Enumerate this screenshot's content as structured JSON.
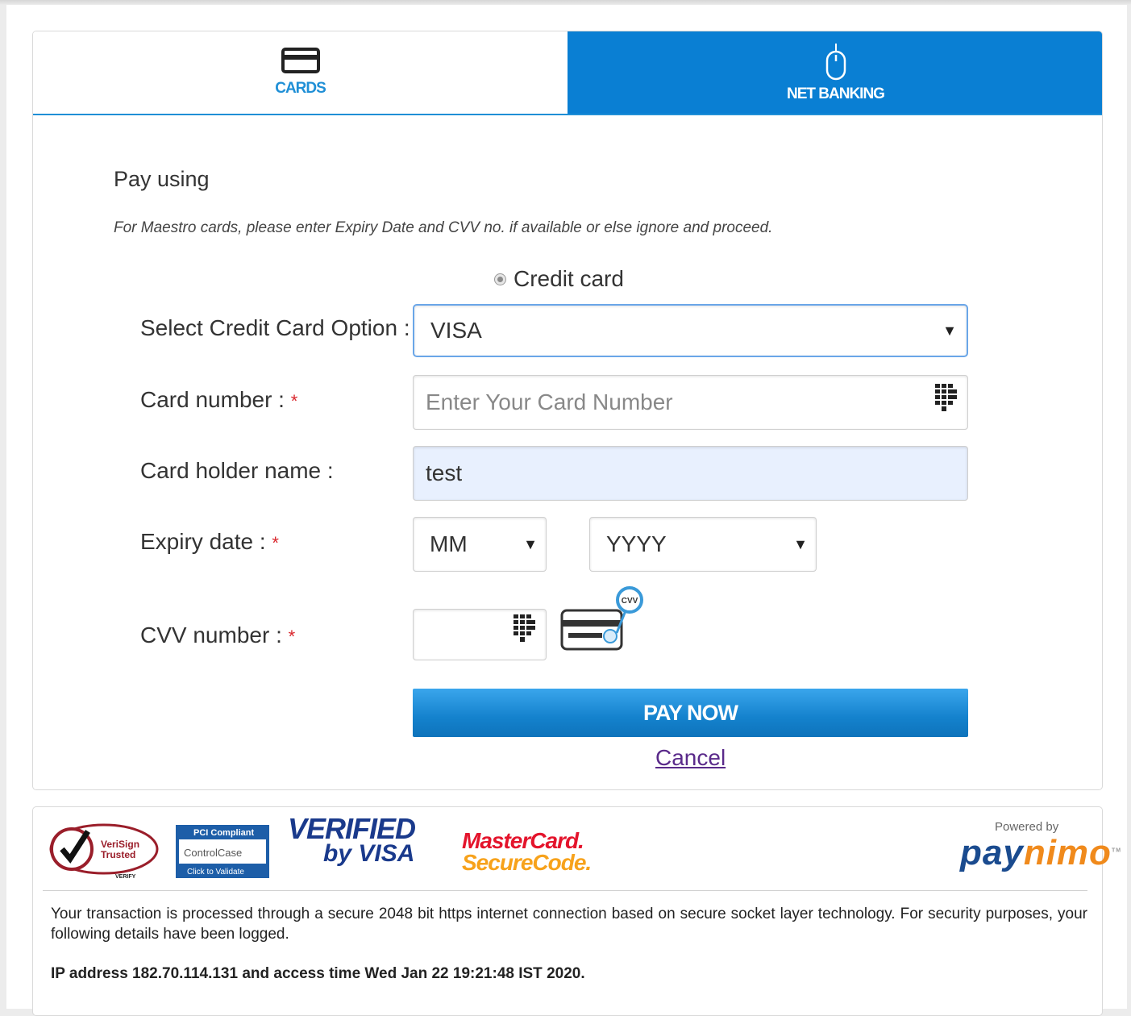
{
  "tabs": {
    "cards": {
      "label": "CARDS",
      "icon": "credit-card-icon"
    },
    "net_banking": {
      "label": "NET BANKING",
      "icon": "mouse-icon"
    }
  },
  "form": {
    "heading": "Pay using",
    "note": "For Maestro cards, please enter Expiry Date and CVV no. if available or else ignore and proceed.",
    "payment_method": {
      "label": "Credit card",
      "selected": true
    },
    "card_option": {
      "label": "Select Credit Card Option :",
      "value": "VISA"
    },
    "card_number": {
      "label": "Card number :",
      "required_mark": "*",
      "placeholder": "Enter Your Card Number",
      "value": ""
    },
    "holder_name": {
      "label": "Card holder name :",
      "value": "test"
    },
    "expiry": {
      "label": "Expiry date :",
      "required_mark": "*",
      "month": "MM",
      "year": "YYYY"
    },
    "cvv": {
      "label": "CVV number :",
      "required_mark": "*",
      "value": "",
      "hint_icon": "cvv-card-icon",
      "hint_text": "CVV"
    },
    "pay_button": "PAY NOW",
    "cancel_link": "Cancel"
  },
  "footer": {
    "badges": {
      "verisign": {
        "line1": "VeriSign",
        "line2": "Trusted",
        "sub": "VERIFY"
      },
      "pci": {
        "line1": "PCI Compliant",
        "line2": "ControlCase",
        "line3": "Click to Validate"
      },
      "verified_by_visa": {
        "line1": "VERIFIED",
        "line2": "by VISA"
      },
      "mastercard": {
        "line1": "MasterCard.",
        "line2": "SecureCode."
      }
    },
    "powered_by": "Powered by",
    "brand_pay": "pay",
    "brand_nimo": "nimo",
    "brand_tm": "TM",
    "security_text": "Your transaction is processed through a secure 2048 bit https internet connection based on secure socket layer technology. For security purposes, your following details have been logged.",
    "ip_text": "IP address 182.70.114.131 and access time Wed Jan 22 19:21:48 IST 2020."
  },
  "colors": {
    "accent": "#0a7fd3",
    "required": "#d9262c",
    "link": "#5a2a8a",
    "autofill": "#e8f0fe"
  }
}
